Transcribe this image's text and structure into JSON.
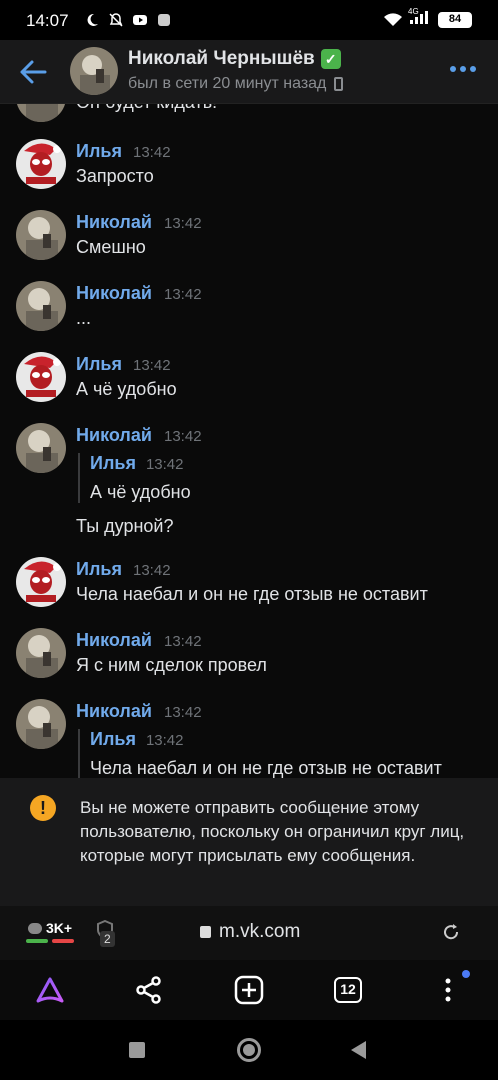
{
  "statusbar": {
    "time": "14:07",
    "network": "4G",
    "battery": "84"
  },
  "header": {
    "name": "Николай Чернышёв",
    "verified_mark": "✓",
    "status": "был в сети 20 минут назад"
  },
  "chat": {
    "partial_top_text": "Он будет кидать!",
    "messages": [
      {
        "author": "Илья",
        "time": "13:42",
        "text": "Запросто"
      },
      {
        "author": "Николай",
        "time": "13:42",
        "text": "Смешно"
      },
      {
        "author": "Николай",
        "time": "13:42",
        "text": "..."
      },
      {
        "author": "Илья",
        "time": "13:42",
        "text": "А чё удобно"
      },
      {
        "author": "Николай",
        "time": "13:42",
        "reply_author": "Илья",
        "reply_time": "13:42",
        "reply_text": "А чё удобно",
        "text": "Ты дурной?"
      },
      {
        "author": "Илья",
        "time": "13:42",
        "text": "Чела наебал и он не где отзыв не оставит"
      },
      {
        "author": "Николай",
        "time": "13:42",
        "text": "Я с ним сделок провел"
      },
      {
        "author": "Николай",
        "time": "13:42",
        "reply_author": "Илья",
        "reply_time": "13:42",
        "reply_text": "Чела наебал и он не где отзыв не оставит"
      }
    ]
  },
  "notice": {
    "icon": "!",
    "text": "Вы не можете отправить сообщение этому пользователю, поскольку он ограничил круг лиц, которые могут присылать ему сообщения."
  },
  "urlbar": {
    "comments_count": "3K+",
    "shield_count": "2",
    "url": "m.vk.com"
  },
  "browserbar": {
    "tabs_count": "12"
  },
  "colors": {
    "accent": "#71aaeb",
    "warning": "#f5a623",
    "background": "#0a0a0a"
  }
}
